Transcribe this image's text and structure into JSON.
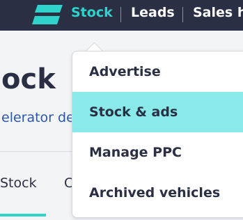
{
  "header": {
    "logo": "brand-logo",
    "nav": [
      {
        "label": "Stock"
      },
      {
        "label": "Leads"
      },
      {
        "label": "Sales h"
      }
    ]
  },
  "page": {
    "title": "ock",
    "subtitle": "elerator de",
    "tabs": [
      {
        "label": "Stock"
      },
      {
        "label": "C"
      }
    ]
  },
  "dropdown": {
    "items": [
      {
        "label": "Advertise"
      },
      {
        "label": "Stock & ads"
      },
      {
        "label": "Manage PPC"
      },
      {
        "label": "Archived vehicles"
      }
    ]
  },
  "colors": {
    "topbar": "#2a2f44",
    "accent": "#2fd3cc",
    "highlight": "#8aeaea",
    "link": "#2a56b0"
  }
}
